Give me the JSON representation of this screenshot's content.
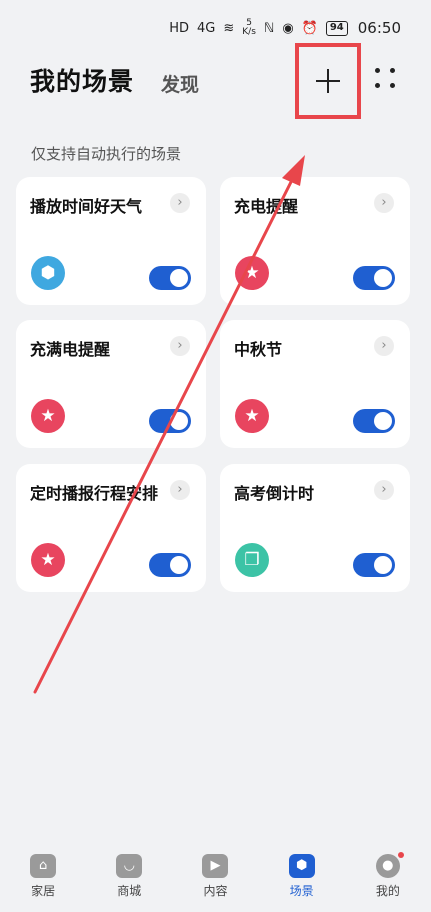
{
  "status_bar": {
    "network": "HD",
    "signal": "4G",
    "speed_value": "5",
    "speed_unit": "K/s",
    "battery": "94",
    "time": "06:50"
  },
  "header": {
    "title": "我的场景",
    "discover_tab": "发现"
  },
  "section_label": "仅支持自动执行的场景",
  "cards": [
    {
      "title": "播放时间好天气",
      "icon": "cube-icon",
      "icon_glyph": "⬢",
      "icon_color": "#3fa8e0",
      "enabled": true
    },
    {
      "title": "充电提醒",
      "icon": "star-icon",
      "icon_glyph": "★",
      "icon_color": "#e8455f",
      "enabled": true
    },
    {
      "title": "充满电提醒",
      "icon": "star-icon",
      "icon_glyph": "★",
      "icon_color": "#e8455f",
      "enabled": true
    },
    {
      "title": "中秋节",
      "icon": "star-icon",
      "icon_glyph": "★",
      "icon_color": "#e8455f",
      "enabled": true
    },
    {
      "title": "定时播报行程安排",
      "icon": "star-icon",
      "icon_glyph": "★",
      "icon_color": "#e8455f",
      "enabled": true
    },
    {
      "title": "高考倒计时",
      "icon": "copy-icon",
      "icon_glyph": "❐",
      "icon_color": "#3cc3a6",
      "enabled": true
    }
  ],
  "nav": {
    "home": "家居",
    "mall": "商城",
    "content": "内容",
    "scenes": "场景",
    "mine": "我的"
  },
  "colors": {
    "accent": "#1f5fd1",
    "highlight": "#e8464b"
  }
}
